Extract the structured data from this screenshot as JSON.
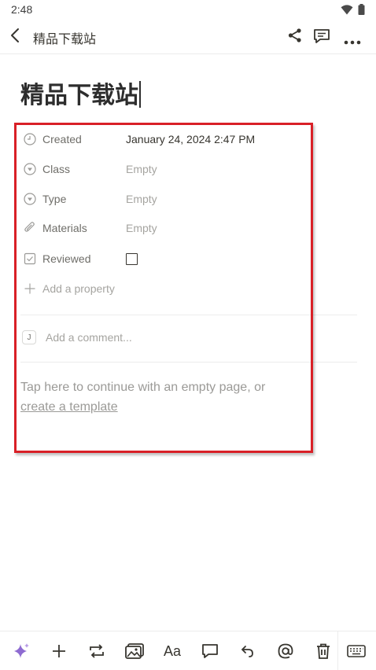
{
  "status_bar": {
    "time": "2:48"
  },
  "top_bar": {
    "title": "精品下载站"
  },
  "page": {
    "title": "精品下载站",
    "properties": [
      {
        "icon": "clock-icon",
        "label": "Created",
        "value": "January 24, 2024 2:47 PM",
        "empty": false
      },
      {
        "icon": "select-circle-icon",
        "label": "Class",
        "value": "Empty",
        "empty": true
      },
      {
        "icon": "select-circle-icon",
        "label": "Type",
        "value": "Empty",
        "empty": true
      },
      {
        "icon": "paperclip-icon",
        "label": "Materials",
        "value": "Empty",
        "empty": true
      },
      {
        "icon": "checkbox-icon",
        "label": "Reviewed",
        "value": "",
        "empty": false
      }
    ],
    "add_property": "Add a property",
    "comment": {
      "avatar_letter": "J",
      "placeholder": "Add a comment..."
    },
    "empty_hint": {
      "text": "Tap here to continue with an empty page, or",
      "link": "create a template"
    }
  },
  "highlight_color": "#d92027",
  "toolbar_icons": [
    "sparkle-icon",
    "plus-icon",
    "turn-into-icon",
    "image-icon",
    "text-style-icon",
    "comment-icon",
    "undo-icon",
    "mention-icon",
    "trash-icon",
    "keyboard-icon"
  ]
}
